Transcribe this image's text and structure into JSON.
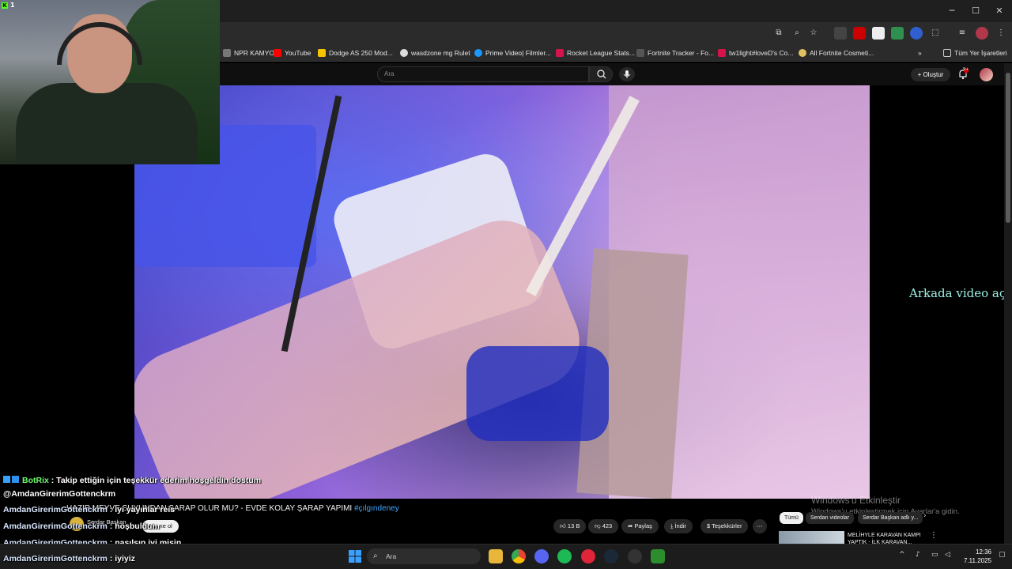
{
  "window": {
    "minimize": "─",
    "maximize": "☐",
    "close": "✕"
  },
  "bookmarks": [
    {
      "label": "NPR KAMYO...",
      "color": "#888888"
    },
    {
      "label": "YouTube",
      "color": "#ff0000"
    },
    {
      "label": "Dodge AS 250 Mod...",
      "color": "#f5c400"
    },
    {
      "label": "wasdzone mg Rulet",
      "color": "#dddddd"
    },
    {
      "label": "Prime Video| Filmler...",
      "color": "#1a98ff"
    },
    {
      "label": "Rocket League Stats...",
      "color": "#d4144b"
    },
    {
      "label": "Fortnite Tracker - Fo...",
      "color": "#555555"
    },
    {
      "label": "tw1light#loveD's Co...",
      "color": "#d4144b"
    },
    {
      "label": "All Fortnite Cosmeti...",
      "color": "#e0c060"
    }
  ],
  "bookmarks_all": "Tüm Yer İşaretleri",
  "youtube": {
    "search_placeholder": "Ara",
    "create_label": "Oluştur",
    "notif_count": "9+"
  },
  "video": {
    "title": "HAZIR MEYVE SUYUNDAN ŞARAP OLUR MU? - EVDE KOLAY ŞARAP YAPIMI",
    "hashtag": "#çılgındeney",
    "channel": "Serdar Başkan",
    "subscribe": "Abone ol",
    "likes": "13 B",
    "dislikes": "423",
    "share": "Paylaş",
    "download": "İndir",
    "thanks": "Teşekkürler",
    "more": "⋯"
  },
  "chips": [
    "Tümü",
    "Serdan videolar",
    "Serdar Başkan adlı y..."
  ],
  "next_video": {
    "title_line1": "MELİHYLE KARAVAN KAMPI",
    "title_line2": "YAPTIK - İLK KARAVAN..."
  },
  "background_text": "Arkada video açık",
  "windows_watermark": {
    "line1": "Windows'u Etkinleştir",
    "line2": "Windows'u etkinleştirmek için Ayarlar'a gidin."
  },
  "webcam": {
    "badge": "1"
  },
  "chat": [
    {
      "user": "BotRix",
      "message": ": Takip ettiğin için teşekkür ederim hoşgeldin dostum",
      "bot": true
    },
    {
      "user": "@AmdanGirerimGottenckrm",
      "message": "",
      "bot": false
    },
    {
      "user": "AmdanGirerimGottenckrm",
      "message": ": iyi yayınlar reis",
      "bot": false
    },
    {
      "user": "AmdanGirerimGottenckrm",
      "message": ": hoşbuldum",
      "bot": false
    },
    {
      "user": "AmdanGirerimGottenckrm",
      "message": ": nasılsın iyi misin",
      "bot": false
    },
    {
      "user": "AmdanGirerimGottenckrm",
      "message": ": iyiyiz",
      "bot": false
    }
  ],
  "taskbar": {
    "search_placeholder": "Ara",
    "time": "12:36",
    "date": "7.11.2025"
  },
  "colors": {
    "accent_blue": "#3ea6ff",
    "bot_green": "#6dfc6d",
    "kick_green": "#53fc18"
  }
}
